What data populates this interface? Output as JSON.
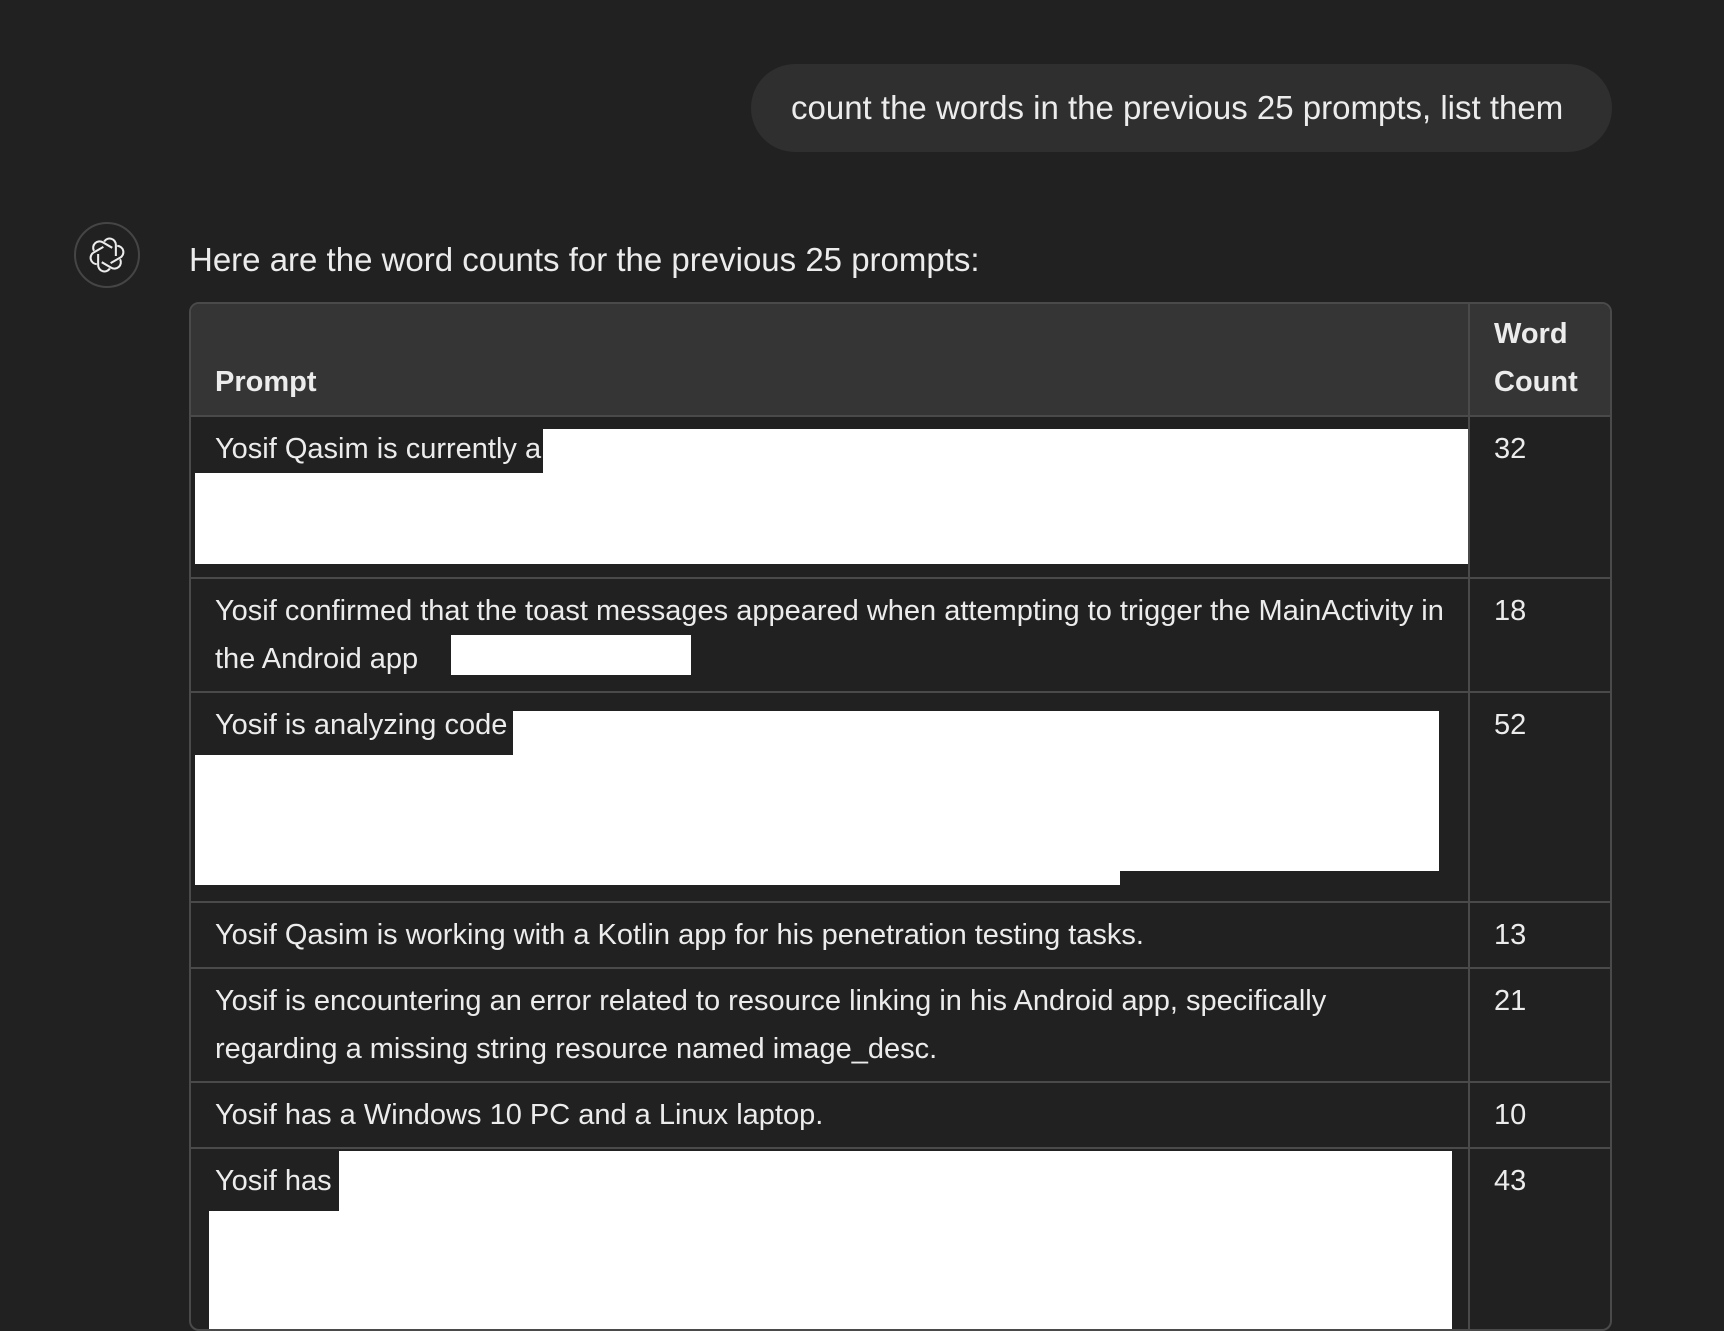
{
  "user_message": "count the words in the previous 25 prompts, list them",
  "assistant": {
    "avatar_icon": "openai-logo-icon",
    "intro": "Here are the word counts for the previous 25 prompts:"
  },
  "table": {
    "headers": {
      "prompt": "Prompt",
      "count": "Word Count"
    },
    "rows": [
      {
        "prompt": "Yosif Qasim is currently a",
        "count": "32"
      },
      {
        "prompt": "Yosif confirmed that the toast messages appeared when attempting to trigger the MainActivity in the Android app",
        "count": "18"
      },
      {
        "prompt": "Yosif is analyzing code",
        "count": "52"
      },
      {
        "prompt": "Yosif Qasim is working with a Kotlin app for his penetration testing tasks.",
        "count": "13"
      },
      {
        "prompt": "Yosif is encountering an error related to resource linking in his Android app, specifically regarding a missing string resource named image_desc.",
        "count": "21"
      },
      {
        "prompt": "Yosif has a Windows 10 PC and a Linux laptop.",
        "count": "10"
      },
      {
        "prompt": "Yosif has",
        "count": "43"
      }
    ]
  }
}
